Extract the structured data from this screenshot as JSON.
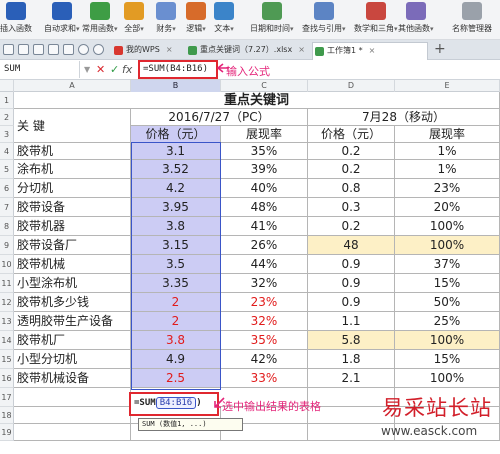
{
  "ribbon": {
    "items": [
      {
        "label": "插入函数",
        "dd": false,
        "color": "#2a5fb8",
        "icon": "fx-icon"
      },
      {
        "label": "自动求和",
        "dd": true,
        "color": "#2a5fb8",
        "icon": "sigma-icon"
      },
      {
        "label": "常用函数",
        "dd": true,
        "color": "#3e9d45",
        "icon": "star-icon"
      },
      {
        "label": "全部",
        "dd": true,
        "color": "#e29b24",
        "icon": "function-icon"
      },
      {
        "label": "财务",
        "dd": true,
        "color": "#6a8fd0",
        "icon": "finance-icon"
      },
      {
        "label": "逻辑",
        "dd": true,
        "color": "#d76b2a",
        "icon": "logic-icon"
      },
      {
        "label": "文本",
        "dd": true,
        "color": "#3b84c9",
        "icon": "text-icon"
      },
      {
        "label": "日期和时间",
        "dd": true,
        "color": "#4f9a54",
        "icon": "calendar-icon"
      },
      {
        "label": "查找与引用",
        "dd": true,
        "color": "#5c84c4",
        "icon": "lookup-icon"
      },
      {
        "label": "数学和三角",
        "dd": true,
        "color": "#c9473f",
        "icon": "math-icon"
      },
      {
        "label": "其他函数",
        "dd": true,
        "color": "#7b6bb9",
        "icon": "more-functions-icon"
      },
      {
        "label": "名称管理器",
        "dd": false,
        "color": "#9aa1aa",
        "icon": "name-manager-icon"
      }
    ]
  },
  "tabs": [
    {
      "label": "我的WPS",
      "color": "#d8372f"
    },
    {
      "label": "重点关键词（7.27）.xlsx",
      "color": "#3f9a4c"
    },
    {
      "label": "工作簿1 *",
      "color": "#3f9a4c"
    }
  ],
  "formula_bar": {
    "name_box": "SUM",
    "cancel": "✕",
    "confirm": "✓",
    "fx": "fx",
    "formula": "=SUM(B4:B16)"
  },
  "annotations": {
    "formula": "输入公式",
    "select_cell": "选中输出结果的表格"
  },
  "columns": [
    "A",
    "B",
    "C",
    "D",
    "E"
  ],
  "rows": [
    "1",
    "2",
    "3",
    "4",
    "5",
    "6",
    "7",
    "8",
    "9",
    "10",
    "11",
    "12",
    "13",
    "14",
    "15",
    "16",
    "17",
    "18",
    "19"
  ],
  "sheet": {
    "title": "重点关键词",
    "group1": "2016/7/27（PC）",
    "group2": "7月28（移动）",
    "keyword_header": "关 键",
    "col_b": "价格（元）",
    "col_c": "展现率",
    "col_d": "价格（元）",
    "col_e": "展现率",
    "data": [
      {
        "k": "胶带机",
        "b": "3.1",
        "c": "35%",
        "d": "0.2",
        "e": "1%",
        "red": false,
        "hl": false
      },
      {
        "k": "涂布机",
        "b": "3.52",
        "c": "39%",
        "d": "0.2",
        "e": "1%",
        "red": false,
        "hl": false
      },
      {
        "k": "分切机",
        "b": "4.2",
        "c": "40%",
        "d": "0.8",
        "e": "23%",
        "red": false,
        "hl": false
      },
      {
        "k": "胶带设备",
        "b": "3.95",
        "c": "48%",
        "d": "0.3",
        "e": "20%",
        "red": false,
        "hl": false
      },
      {
        "k": "胶带机器",
        "b": "3.8",
        "c": "41%",
        "d": "0.2",
        "e": "100%",
        "red": false,
        "hl": false
      },
      {
        "k": "胶带设备厂",
        "b": "3.15",
        "c": "26%",
        "d": "48",
        "e": "100%",
        "red": false,
        "hl": true
      },
      {
        "k": "胶带机械",
        "b": "3.5",
        "c": "44%",
        "d": "0.9",
        "e": "37%",
        "red": false,
        "hl": false
      },
      {
        "k": "小型涂布机",
        "b": "3.35",
        "c": "32%",
        "d": "0.9",
        "e": "15%",
        "red": false,
        "hl": false
      },
      {
        "k": "胶带机多少钱",
        "b": "2",
        "c": "23%",
        "d": "0.9",
        "e": "50%",
        "red": true,
        "hl": false
      },
      {
        "k": "透明胶带生产设备",
        "b": "2",
        "c": "32%",
        "d": "1.1",
        "e": "25%",
        "red": true,
        "hl": false
      },
      {
        "k": "胶带机厂",
        "b": "3.8",
        "c": "35%",
        "d": "5.8",
        "e": "100%",
        "red": true,
        "hl": true
      },
      {
        "k": "小型分切机",
        "b": "4.9",
        "c": "42%",
        "d": "1.8",
        "e": "15%",
        "red": false,
        "hl": false
      },
      {
        "k": "胶带机械设备",
        "b": "2.5",
        "c": "33%",
        "d": "2.1",
        "e": "100%",
        "red": true,
        "hl": false
      }
    ]
  },
  "editing": {
    "prefix": "=SUM",
    "ref": "B4:B16",
    "suffix": ")",
    "tooltip": "SUM (数值1, ...)"
  },
  "watermark": {
    "brand": "易采站长站",
    "url": "www.easck.com"
  }
}
